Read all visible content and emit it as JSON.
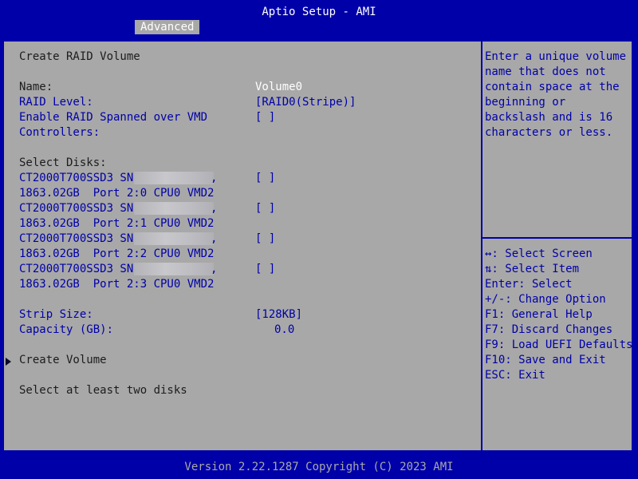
{
  "header": {
    "title": "Aptio Setup - AMI",
    "tab": "Advanced"
  },
  "main": {
    "heading": "Create RAID Volume",
    "name_label": "Name:",
    "name_value": "Volume0",
    "raid_level_label": "RAID Level:",
    "raid_level_value": "[RAID0(Stripe)]",
    "spanned_label_1": "Enable RAID Spanned over VMD",
    "spanned_label_2": "Controllers:",
    "spanned_value": "[ ]",
    "select_disks_label": "Select Disks:",
    "disks": [
      {
        "model": "CT2000T700SSD3 SN:",
        "comma": ",",
        "check": "[ ]",
        "detail": "1863.02GB  Port 2:0 CPU0 VMD2"
      },
      {
        "model": "CT2000T700SSD3 SN:",
        "comma": ",",
        "check": "[ ]",
        "detail": "1863.02GB  Port 2:1 CPU0 VMD2"
      },
      {
        "model": "CT2000T700SSD3 SN:",
        "comma": ",",
        "check": "[ ]",
        "detail": "1863.02GB  Port 2:2 CPU0 VMD2"
      },
      {
        "model": "CT2000T700SSD3 SN:",
        "comma": ",",
        "check": "[ ]",
        "detail": "1863.02GB  Port 2:3 CPU0 VMD2"
      }
    ],
    "strip_size_label": "Strip Size:",
    "strip_size_value": "[128KB]",
    "capacity_label": "Capacity (GB):",
    "capacity_value": "0.0",
    "create_volume": "Create Volume",
    "status": "Select at least two disks"
  },
  "help": {
    "lines": [
      "Enter a unique volume",
      "name that does not",
      "contain space at the",
      "beginning or",
      "backslash and is 16",
      "characters or less."
    ]
  },
  "keys": [
    "↔: Select Screen",
    "⇅: Select Item",
    "Enter: Select",
    "+/-: Change Option",
    "F1: General Help",
    "F7: Discard Changes",
    "F9: Load UEFI Defaults",
    "F10: Save and Exit",
    "ESC: Exit"
  ],
  "footer": {
    "version": "Version 2.22.1287 Copyright (C) 2023 AMI"
  },
  "colors": {
    "blue": "#0000a8",
    "gray": "#a8a8a8",
    "white": "#ffffff"
  }
}
